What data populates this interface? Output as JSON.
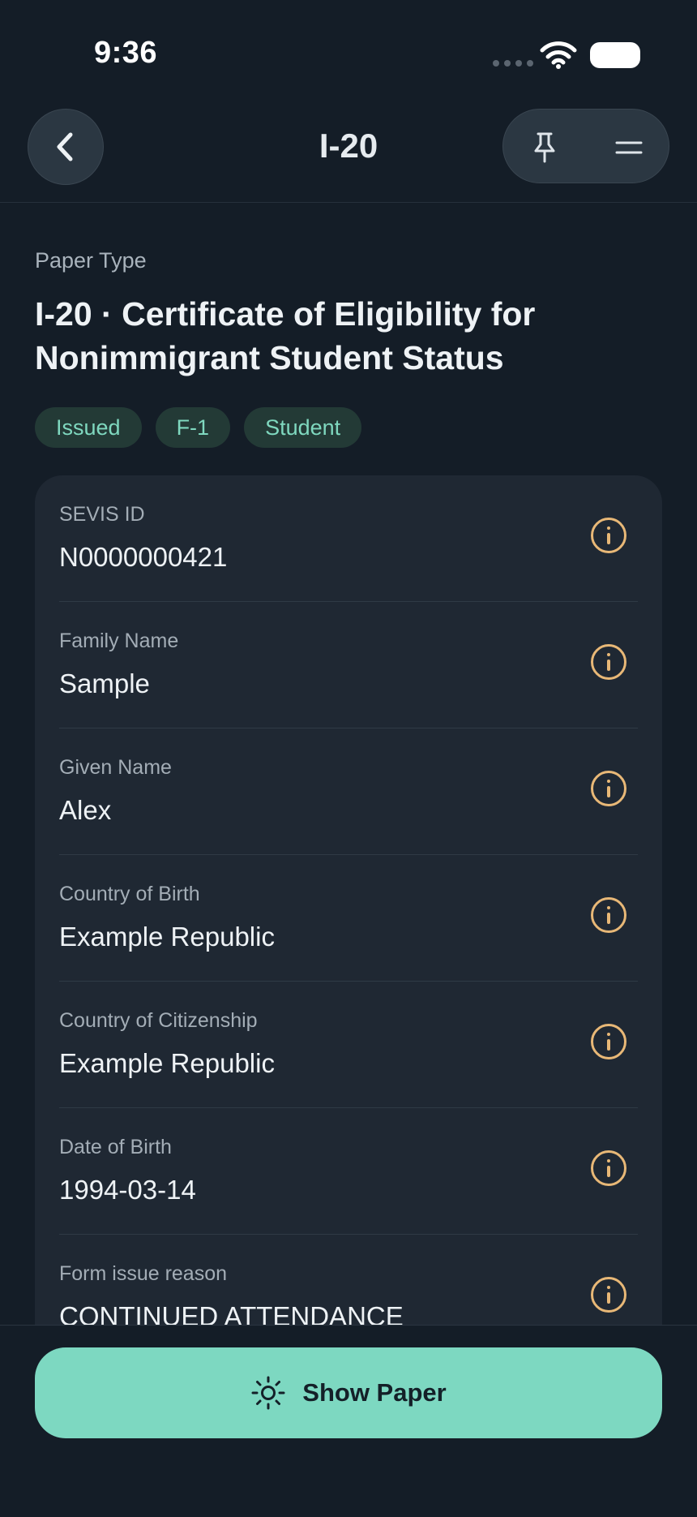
{
  "status_bar": {
    "time": "9:36"
  },
  "nav": {
    "title": "I-20"
  },
  "header": {
    "paper_type_label": "Paper Type",
    "paper_title": "I-20 · Certificate of Eligibility for Nonimmigrant Student Status",
    "tags": [
      "Issued",
      "F-1",
      "Student"
    ]
  },
  "fields": [
    {
      "label": "SEVIS ID",
      "value": "N0000000421"
    },
    {
      "label": "Family Name",
      "value": "Sample"
    },
    {
      "label": "Given Name",
      "value": "Alex"
    },
    {
      "label": "Country of Birth",
      "value": "Example Republic"
    },
    {
      "label": "Country of Citizenship",
      "value": "Example Republic"
    },
    {
      "label": "Date of Birth",
      "value": "1994-03-14"
    },
    {
      "label": "Form issue reason",
      "value": "CONTINUED ATTENDANCE"
    }
  ],
  "footer": {
    "show_paper_label": "Show Paper"
  },
  "colors": {
    "background": "#141d27",
    "card": "#1f2833",
    "accent": "#7dd8c1",
    "tag_text": "#7fd8bf",
    "info_icon": "#e8b877"
  },
  "icons": {
    "back": "chevron-left-icon",
    "pin": "pin-icon",
    "menu": "menu-icon",
    "info": "info-icon",
    "show_paper": "sun-icon"
  }
}
